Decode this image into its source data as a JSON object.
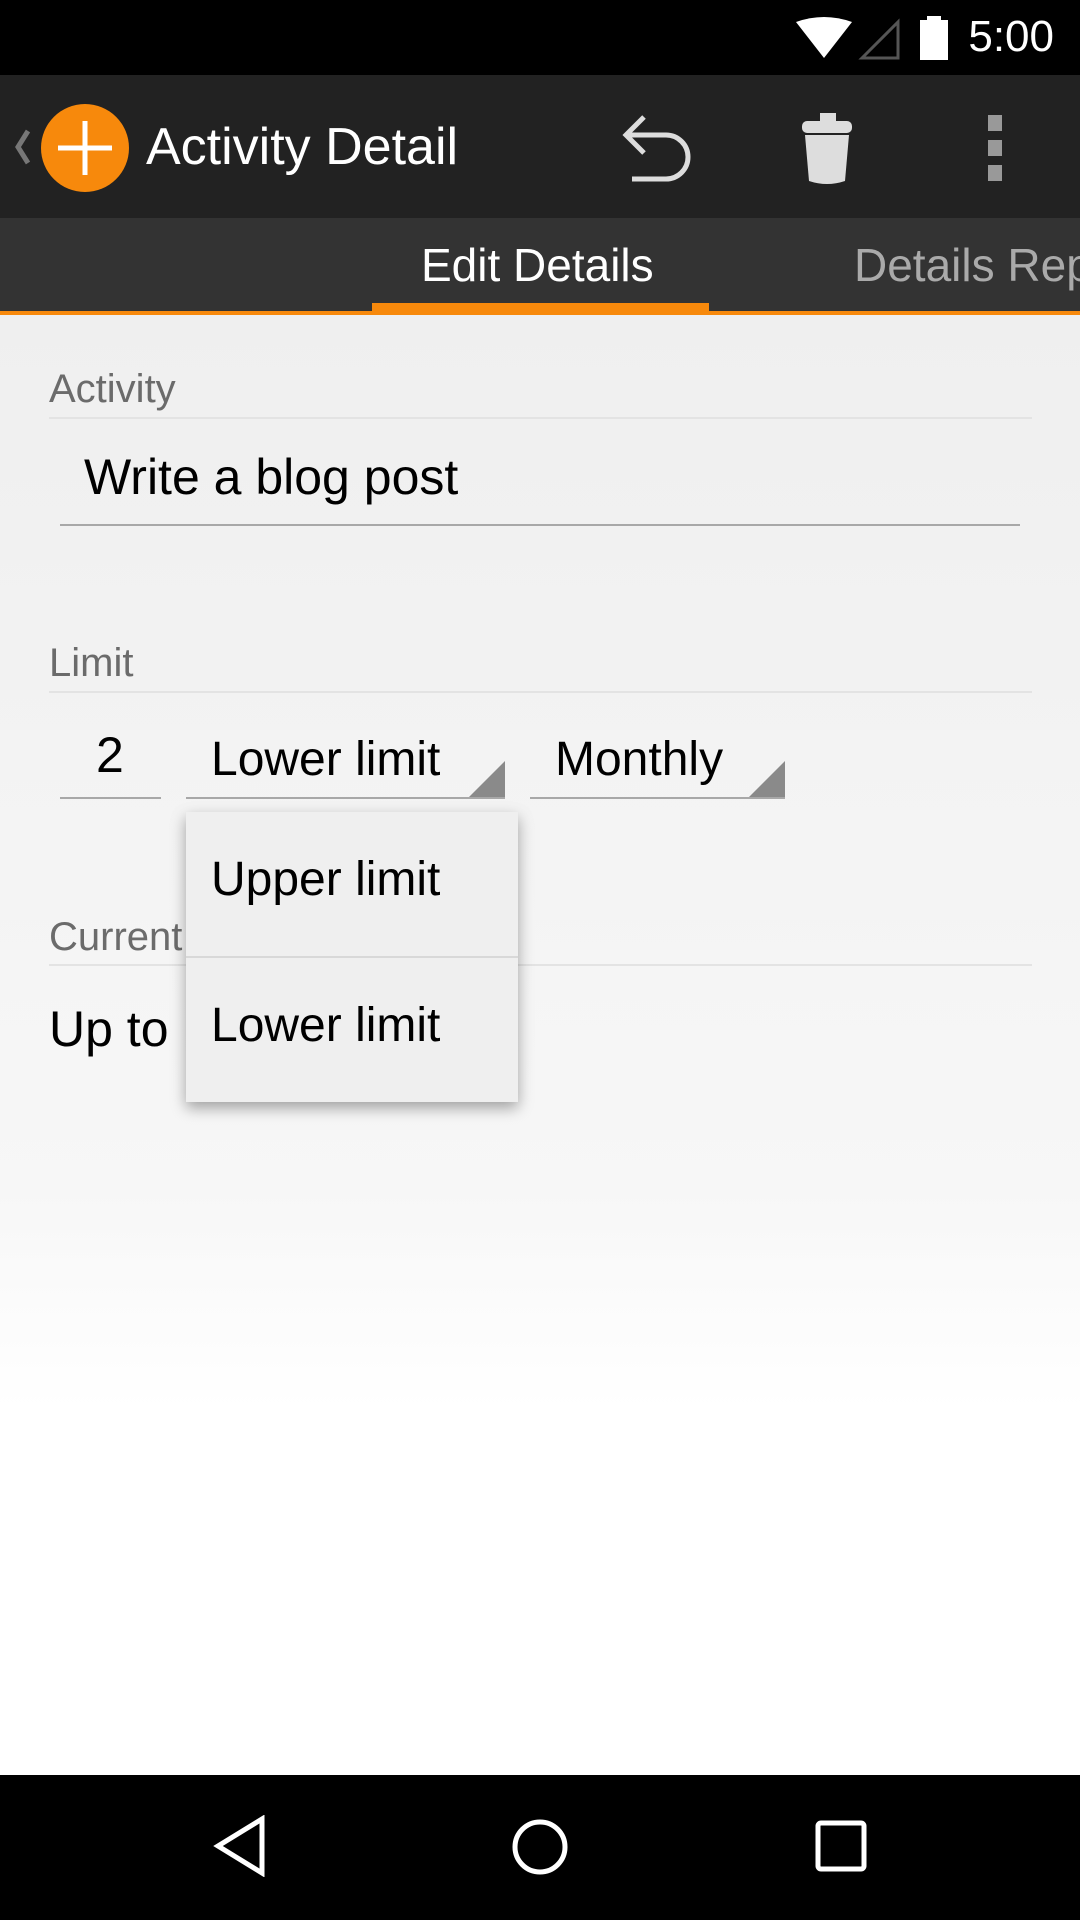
{
  "status_bar": {
    "time": "5:00",
    "icons": [
      "wifi-icon",
      "signal-icon",
      "battery-icon"
    ]
  },
  "action_bar": {
    "title": "Activity Detail",
    "icons": [
      "back-chevron-icon",
      "app-add-icon",
      "undo-icon",
      "trash-icon",
      "overflow-menu-icon"
    ],
    "accent": "#f7890c"
  },
  "tabs": [
    {
      "label": "Edit Details",
      "selected": true
    },
    {
      "label": "Details Rep",
      "selected": false
    }
  ],
  "form": {
    "activity_label": "Activity",
    "activity_value": "Write a blog post",
    "limit_label": "Limit",
    "limit_number": "2",
    "limit_type": "Lower limit",
    "limit_period": "Monthly",
    "current_label": "Current",
    "current_value": "Up to"
  },
  "dropdown": {
    "options": [
      "Upper limit",
      "Lower limit"
    ]
  },
  "nav_bar": {
    "icons": [
      "back-icon",
      "home-icon",
      "recents-icon"
    ]
  }
}
